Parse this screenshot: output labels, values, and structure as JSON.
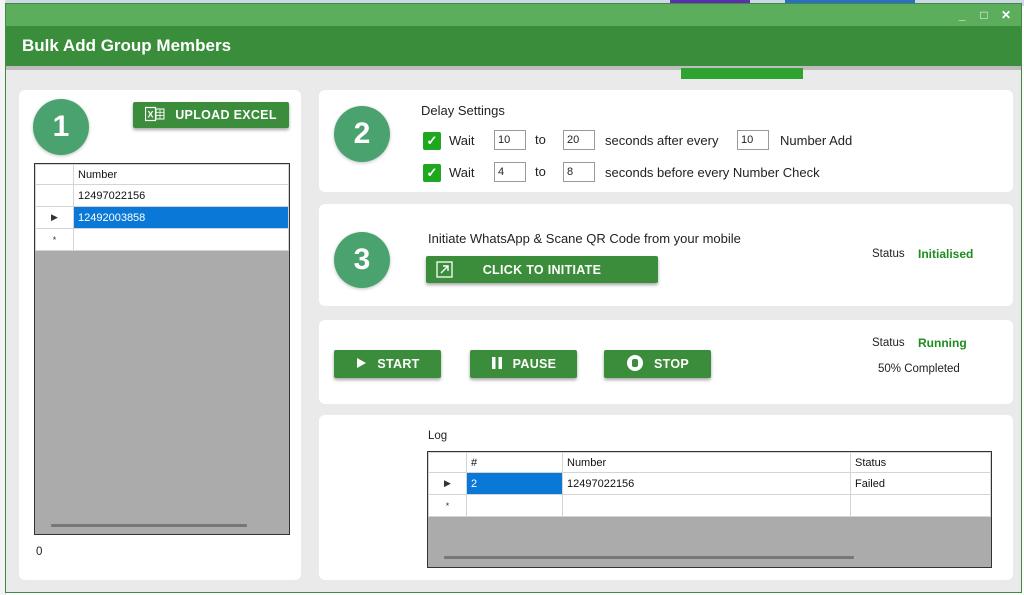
{
  "window": {
    "title": "Bulk Add Group Members",
    "controls": {
      "minimize": "_",
      "maximize": "□",
      "close": "✕"
    }
  },
  "step1": {
    "number": "1",
    "upload_label": "UPLOAD EXCEL",
    "upload_icon": "excel-icon",
    "grid": {
      "header": "Number",
      "rows": [
        {
          "indicator": "",
          "value": "12497022156",
          "selected": false
        },
        {
          "indicator": "▶",
          "value": "12492003858",
          "selected": true
        },
        {
          "indicator": "*",
          "value": "",
          "selected": false
        }
      ]
    },
    "count": "0"
  },
  "step2": {
    "number": "2",
    "title": "Delay Settings",
    "row1": {
      "wait": "Wait",
      "from": "10",
      "to_label": "to",
      "to": "20",
      "after_text": "seconds after every",
      "every": "10",
      "suffix": "Number Add"
    },
    "row2": {
      "wait": "Wait",
      "from": "4",
      "to_label": "to",
      "to": "8",
      "after_text": "seconds before every Number Check"
    }
  },
  "step3": {
    "number": "3",
    "instruction": "Initiate WhatsApp & Scane QR Code from your mobile",
    "button_label": "CLICK TO INITIATE",
    "button_icon": "external-link-icon",
    "status_label": "Status",
    "status_value": "Initialised"
  },
  "controls": {
    "start_label": "START",
    "pause_label": "PAUSE",
    "stop_label": "STOP",
    "status_label": "Status",
    "status_value": "Running",
    "progress_text": "50% Completed",
    "progress_percent": 50
  },
  "log": {
    "title": "Log",
    "columns": [
      "#",
      "Number",
      "Status"
    ],
    "rows": [
      {
        "indicator": "▶",
        "index": "2",
        "number": "12497022156",
        "status": "Failed"
      },
      {
        "indicator": "*",
        "index": "",
        "number": "",
        "status": ""
      }
    ]
  },
  "colors": {
    "header_green": "#3a8d3a",
    "button_green": "#3b8d3b",
    "circle_green": "#4aa36f",
    "status_green": "#1e8c1e",
    "selection_blue": "#0a78d7"
  }
}
